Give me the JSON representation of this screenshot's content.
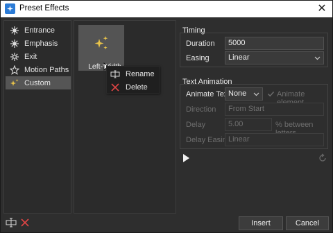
{
  "window": {
    "title": "Preset Effects",
    "close_glyph": "✕"
  },
  "sidebar": {
    "items": [
      {
        "label": "Entrance",
        "icon": "star-burst-icon"
      },
      {
        "label": "Emphasis",
        "icon": "star-burst-icon"
      },
      {
        "label": "Exit",
        "icon": "star-burst-icon"
      },
      {
        "label": "Motion Paths",
        "icon": "star-outline-icon"
      },
      {
        "label": "Custom",
        "icon": "sparkles-icon",
        "selected": true
      }
    ]
  },
  "grid": {
    "tile_label": "Left-Width"
  },
  "context_menu": {
    "items": [
      {
        "label": "Rename"
      },
      {
        "label": "Delete"
      }
    ]
  },
  "timing": {
    "title": "Timing",
    "duration_label": "Duration",
    "duration_value": "5000",
    "easing_label": "Easing",
    "easing_value": "Linear"
  },
  "text_animation": {
    "title": "Text Animation",
    "animate_text_label": "Animate Text",
    "animate_text_value": "None",
    "animate_element_label": "Animate element",
    "direction_label": "Direction",
    "direction_value": "From Start",
    "delay_label": "Delay",
    "delay_value": "5.00",
    "delay_suffix": "% between letters",
    "delay_easing_label": "Delay Easing",
    "delay_easing_value": "Linear"
  },
  "footer": {
    "insert_label": "Insert",
    "cancel_label": "Cancel"
  },
  "colors": {
    "accent": "#2b7bd6",
    "delete_red": "#e04545",
    "sparkle": "#e8c34a"
  }
}
